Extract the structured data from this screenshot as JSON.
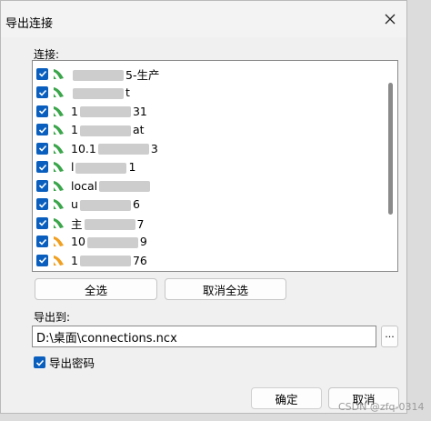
{
  "dialog": {
    "title": "导出连接",
    "connections_label": "连接:",
    "connections": [
      {
        "prefix": "",
        "suffix": "5-生产",
        "icon": "green-connection-icon",
        "checked": true
      },
      {
        "prefix": "",
        "suffix": "t",
        "icon": "green-connection-icon",
        "checked": true
      },
      {
        "prefix": "1",
        "suffix": "31",
        "icon": "green-connection-icon",
        "checked": true
      },
      {
        "prefix": "1",
        "suffix": "at",
        "icon": "green-connection-icon",
        "checked": true
      },
      {
        "prefix": "10.1",
        "suffix": "3",
        "icon": "green-connection-icon",
        "checked": true
      },
      {
        "prefix": "l",
        "suffix": "1",
        "icon": "green-connection-icon",
        "checked": true
      },
      {
        "prefix": "local",
        "suffix": "",
        "icon": "green-connection-icon",
        "checked": true
      },
      {
        "prefix": "u",
        "suffix": "6",
        "icon": "green-connection-icon",
        "checked": true
      },
      {
        "prefix": "主",
        "suffix": "7",
        "icon": "green-connection-icon",
        "checked": true
      },
      {
        "prefix": "10",
        "suffix": "9",
        "icon": "orange-connection-icon",
        "checked": true
      },
      {
        "prefix": "1",
        "suffix": "76",
        "icon": "orange-connection-icon",
        "checked": true
      }
    ],
    "select_all": "全选",
    "deselect_all": "取消全选",
    "export_to_label": "导出到:",
    "export_path": "D:\\桌面\\connections.ncx",
    "browse_label": "...",
    "export_password_label": "导出密码",
    "export_password_checked": true,
    "ok": "确定",
    "cancel": "取消"
  },
  "watermark": "CSDN @zfq-0314",
  "colors": {
    "checkbox": "#0a5fbe",
    "green_icon": "#3aa54a",
    "orange_icon": "#f0a020"
  }
}
